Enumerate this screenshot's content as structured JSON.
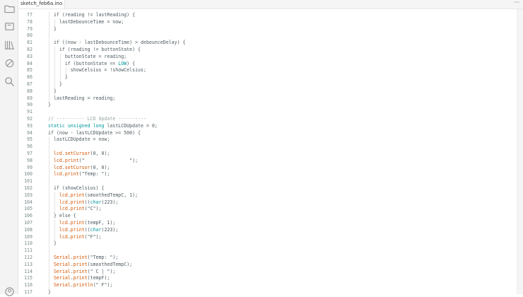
{
  "tab": {
    "filename": "sketch_feb6a.ino",
    "more_label": "···"
  },
  "activity_icons": [
    "folder-icon",
    "board-icon",
    "library-icon",
    "debug-icon",
    "search-icon"
  ],
  "colors": {
    "keyword": "#00979c",
    "function": "#d35400",
    "comment": "#95a5a6",
    "text": "#4e5b61",
    "line_number": "#7a8a8a"
  },
  "code_lines": [
    {
      "ln": "77",
      "tokens": [
        [
          "t",
          "  if (reading != lastReading) {"
        ]
      ]
    },
    {
      "ln": "78",
      "tokens": [
        [
          "t",
          "    lastDebounceTime = now;"
        ]
      ]
    },
    {
      "ln": "79",
      "tokens": [
        [
          "t",
          "  }"
        ]
      ]
    },
    {
      "ln": "80",
      "tokens": []
    },
    {
      "ln": "81",
      "tokens": [
        [
          "t",
          "  if ((now - lastDebounceTime) > debounceDelay) {"
        ]
      ]
    },
    {
      "ln": "82",
      "tokens": [
        [
          "t",
          "    if (reading != buttonState) {"
        ]
      ]
    },
    {
      "ln": "83",
      "tokens": [
        [
          "t",
          "      buttonState = reading;"
        ]
      ]
    },
    {
      "ln": "84",
      "tokens": [
        [
          "t",
          "      if (buttonState == "
        ],
        [
          "k",
          "LOW"
        ],
        [
          "t",
          ") {"
        ]
      ]
    },
    {
      "ln": "85",
      "tokens": [
        [
          "t",
          "        showCelsius = !showCelsius;"
        ]
      ]
    },
    {
      "ln": "86",
      "tokens": [
        [
          "t",
          "      }"
        ]
      ]
    },
    {
      "ln": "87",
      "tokens": [
        [
          "t",
          "    }"
        ]
      ]
    },
    {
      "ln": "88",
      "tokens": [
        [
          "t",
          "  }"
        ]
      ]
    },
    {
      "ln": "89",
      "tokens": [
        [
          "t",
          "  lastReading = reading;"
        ]
      ]
    },
    {
      "ln": "90",
      "tokens": [
        [
          "t",
          "}"
        ]
      ]
    },
    {
      "ln": "91",
      "tokens": []
    },
    {
      "ln": "92",
      "tokens": [
        [
          "c",
          "// ---------- LCD Update ----------"
        ]
      ]
    },
    {
      "ln": "93",
      "tokens": [
        [
          "k",
          "static"
        ],
        [
          "t",
          " "
        ],
        [
          "k",
          "unsigned"
        ],
        [
          "t",
          " "
        ],
        [
          "k",
          "long"
        ],
        [
          "t",
          " lastLCDUpdate = 0;"
        ]
      ]
    },
    {
      "ln": "94",
      "tokens": [
        [
          "t",
          "if (now - lastLCDUpdate >= 500) {"
        ]
      ]
    },
    {
      "ln": "95",
      "tokens": [
        [
          "t",
          "  lastLCDUpdate = now;"
        ]
      ]
    },
    {
      "ln": "96",
      "tokens": []
    },
    {
      "ln": "97",
      "tokens": [
        [
          "t",
          "  "
        ],
        [
          "f",
          "lcd"
        ],
        [
          "t",
          "."
        ],
        [
          "f",
          "setCursor"
        ],
        [
          "t",
          "(0, 0);"
        ]
      ]
    },
    {
      "ln": "98",
      "tokens": [
        [
          "t",
          "  "
        ],
        [
          "f",
          "lcd"
        ],
        [
          "t",
          "."
        ],
        [
          "f",
          "print"
        ],
        [
          "t",
          "(\"                \");"
        ]
      ]
    },
    {
      "ln": "99",
      "tokens": [
        [
          "t",
          "  "
        ],
        [
          "f",
          "lcd"
        ],
        [
          "t",
          "."
        ],
        [
          "f",
          "setCursor"
        ],
        [
          "t",
          "(0, 0);"
        ]
      ]
    },
    {
      "ln": "100",
      "tokens": [
        [
          "t",
          "  "
        ],
        [
          "f",
          "lcd"
        ],
        [
          "t",
          "."
        ],
        [
          "f",
          "print"
        ],
        [
          "t",
          "(\"Temp: \");"
        ]
      ]
    },
    {
      "ln": "101",
      "tokens": []
    },
    {
      "ln": "102",
      "tokens": [
        [
          "t",
          "  if (showCelsius) {"
        ]
      ]
    },
    {
      "ln": "103",
      "tokens": [
        [
          "t",
          "    "
        ],
        [
          "f",
          "lcd"
        ],
        [
          "t",
          "."
        ],
        [
          "f",
          "print"
        ],
        [
          "t",
          "(smoothedTempC, 1);"
        ]
      ]
    },
    {
      "ln": "104",
      "tokens": [
        [
          "t",
          "    "
        ],
        [
          "f",
          "lcd"
        ],
        [
          "t",
          "."
        ],
        [
          "f",
          "print"
        ],
        [
          "t",
          "(("
        ],
        [
          "k",
          "char"
        ],
        [
          "t",
          ")223);"
        ]
      ]
    },
    {
      "ln": "105",
      "tokens": [
        [
          "t",
          "    "
        ],
        [
          "f",
          "lcd"
        ],
        [
          "t",
          "."
        ],
        [
          "f",
          "print"
        ],
        [
          "t",
          "(\"C\");"
        ]
      ]
    },
    {
      "ln": "106",
      "tokens": [
        [
          "t",
          "  } else {"
        ]
      ]
    },
    {
      "ln": "107",
      "tokens": [
        [
          "t",
          "    "
        ],
        [
          "f",
          "lcd"
        ],
        [
          "t",
          "."
        ],
        [
          "f",
          "print"
        ],
        [
          "t",
          "(tempF, 1);"
        ]
      ]
    },
    {
      "ln": "108",
      "tokens": [
        [
          "t",
          "    "
        ],
        [
          "f",
          "lcd"
        ],
        [
          "t",
          "."
        ],
        [
          "f",
          "print"
        ],
        [
          "t",
          "(("
        ],
        [
          "k",
          "char"
        ],
        [
          "t",
          ")223);"
        ]
      ]
    },
    {
      "ln": "109",
      "tokens": [
        [
          "t",
          "    "
        ],
        [
          "f",
          "lcd"
        ],
        [
          "t",
          "."
        ],
        [
          "f",
          "print"
        ],
        [
          "t",
          "(\"F\");"
        ]
      ]
    },
    {
      "ln": "110",
      "tokens": [
        [
          "t",
          "  }"
        ]
      ]
    },
    {
      "ln": "111",
      "tokens": []
    },
    {
      "ln": "112",
      "tokens": [
        [
          "t",
          "  "
        ],
        [
          "f",
          "Serial"
        ],
        [
          "t",
          "."
        ],
        [
          "f",
          "print"
        ],
        [
          "t",
          "(\"Temp: \");"
        ]
      ]
    },
    {
      "ln": "113",
      "tokens": [
        [
          "t",
          "  "
        ],
        [
          "f",
          "Serial"
        ],
        [
          "t",
          "."
        ],
        [
          "f",
          "print"
        ],
        [
          "t",
          "(smoothedTempC);"
        ]
      ]
    },
    {
      "ln": "114",
      "tokens": [
        [
          "t",
          "  "
        ],
        [
          "f",
          "Serial"
        ],
        [
          "t",
          "."
        ],
        [
          "f",
          "print"
        ],
        [
          "t",
          "(\" C | \");"
        ]
      ]
    },
    {
      "ln": "115",
      "tokens": [
        [
          "t",
          "  "
        ],
        [
          "f",
          "Serial"
        ],
        [
          "t",
          "."
        ],
        [
          "f",
          "print"
        ],
        [
          "t",
          "(tempF);"
        ]
      ]
    },
    {
      "ln": "116",
      "tokens": [
        [
          "t",
          "  "
        ],
        [
          "f",
          "Serial"
        ],
        [
          "t",
          "."
        ],
        [
          "f",
          "println"
        ],
        [
          "t",
          "(\" F\");"
        ]
      ]
    },
    {
      "ln": "117",
      "tokens": [
        [
          "t",
          "}"
        ]
      ]
    }
  ]
}
